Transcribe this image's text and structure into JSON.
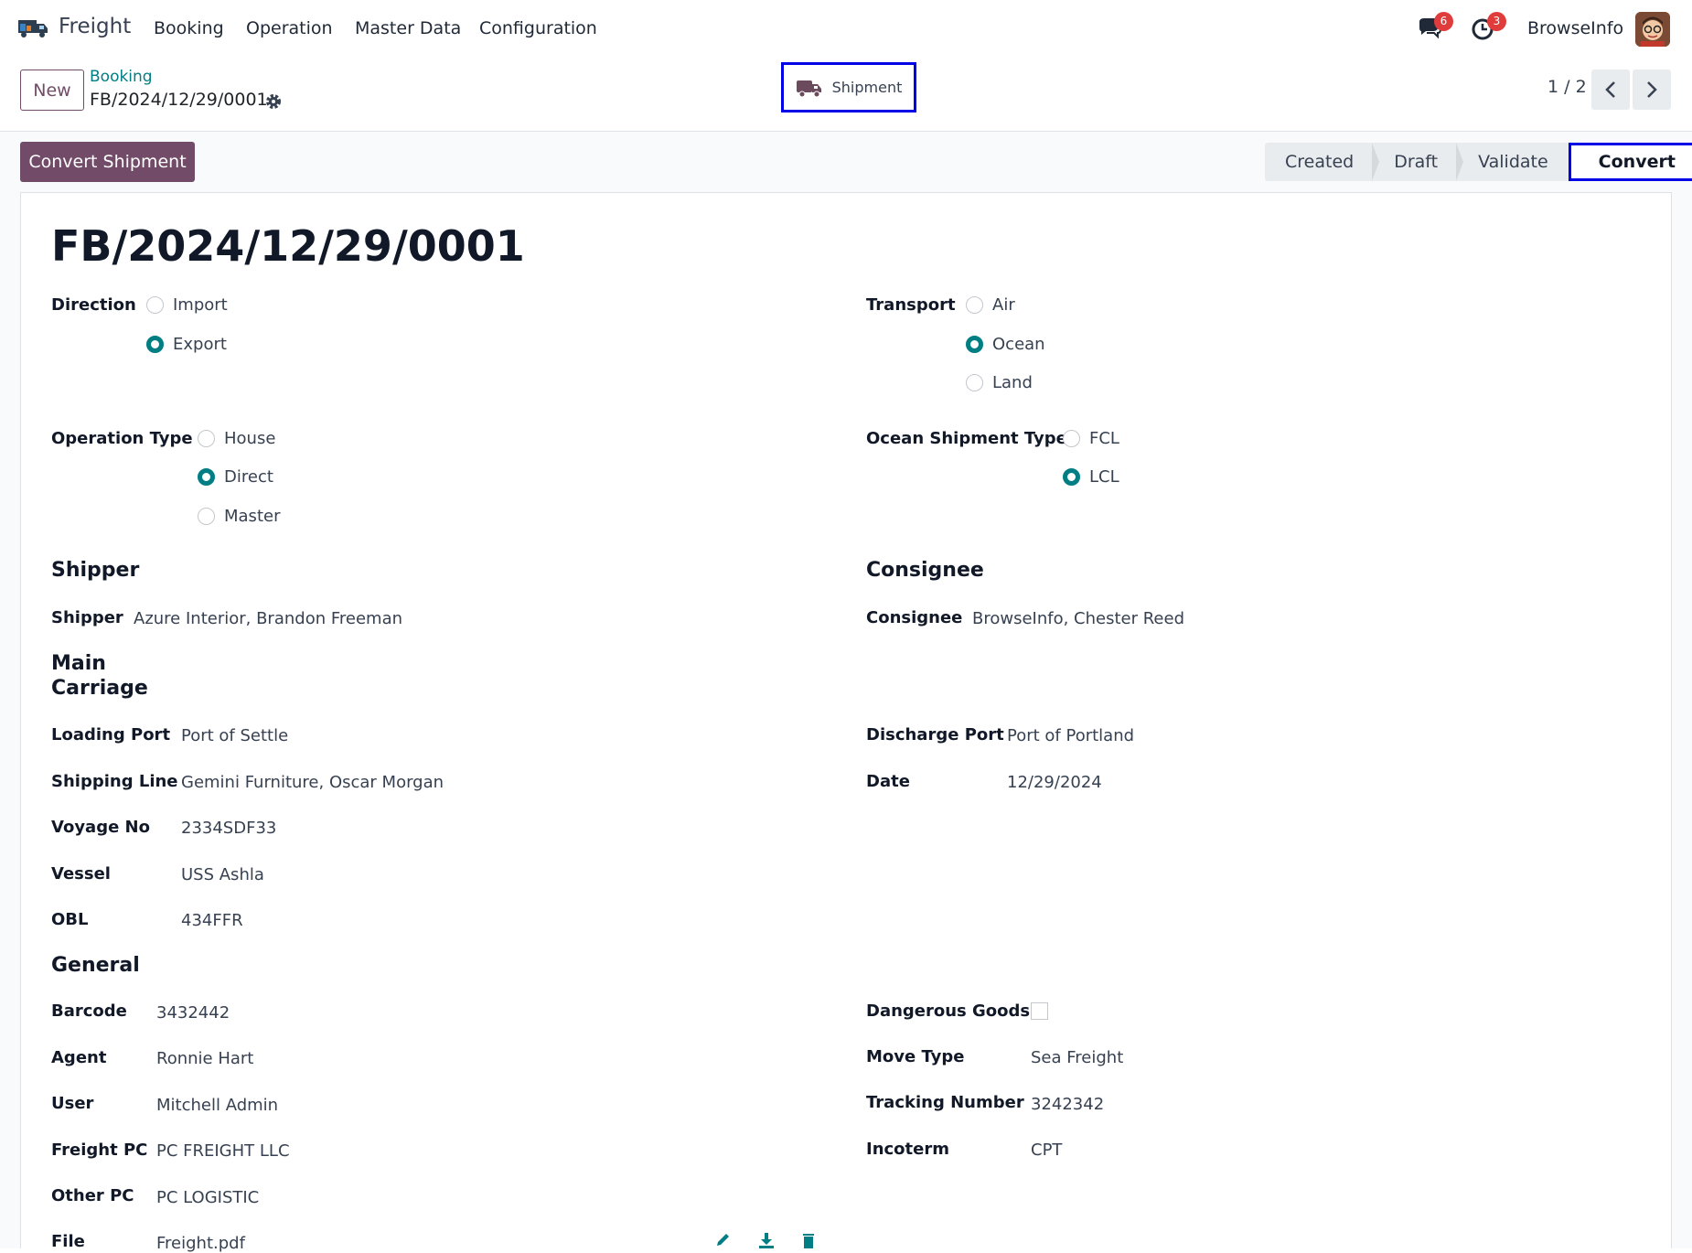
{
  "navbar": {
    "app_name": "Freight",
    "menu": [
      "Booking",
      "Operation",
      "Master Data",
      "Configuration"
    ],
    "messages_count": "6",
    "activities_count": "3",
    "user_name": "BrowseInfo"
  },
  "control": {
    "new_label": "New",
    "breadcrumb_parent": "Booking",
    "breadcrumb_current": "FB/2024/12/29/0001",
    "smart_button_label": "Shipment",
    "pager": "1 / 2"
  },
  "statusbar": {
    "action_label": "Convert Shipment",
    "stages": [
      "Created",
      "Draft",
      "Validate",
      "Convert"
    ],
    "active_stage": "Convert"
  },
  "form": {
    "title": "FB/2024/12/29/0001",
    "direction": {
      "label": "Direction",
      "options": [
        "Import",
        "Export"
      ],
      "selected": "Export"
    },
    "transport": {
      "label": "Transport",
      "options": [
        "Air",
        "Ocean",
        "Land"
      ],
      "selected": "Ocean"
    },
    "operation_type": {
      "label": "Operation Type",
      "options": [
        "House",
        "Direct",
        "Master"
      ],
      "selected": "Direct"
    },
    "ocean_shipment_type": {
      "label": "Ocean Shipment Type",
      "options": [
        "FCL",
        "LCL"
      ],
      "selected": "LCL"
    },
    "shipper_section": "Shipper",
    "consignee_section": "Consignee",
    "shipper": {
      "label": "Shipper",
      "value": "Azure Interior, Brandon Freeman"
    },
    "consignee": {
      "label": "Consignee",
      "value": "BrowseInfo, Chester Reed"
    },
    "main_carriage_section": "Main Carriage",
    "loading_port": {
      "label": "Loading Port",
      "value": "Port of Settle"
    },
    "discharge_port": {
      "label": "Discharge Port",
      "value": "Port of Portland"
    },
    "shipping_line": {
      "label": "Shipping Line",
      "value": "Gemini Furniture, Oscar Morgan"
    },
    "date": {
      "label": "Date",
      "value": "12/29/2024"
    },
    "voyage_no": {
      "label": "Voyage No",
      "value": "2334SDF33"
    },
    "vessel": {
      "label": "Vessel",
      "value": "USS Ashla"
    },
    "obl": {
      "label": "OBL",
      "value": "434FFR"
    },
    "general_section": "General",
    "barcode": {
      "label": "Barcode",
      "value": "3432442"
    },
    "dangerous_goods": {
      "label": "Dangerous Goods",
      "checked": false
    },
    "agent": {
      "label": "Agent",
      "value": "Ronnie Hart"
    },
    "move_type": {
      "label": "Move Type",
      "value": "Sea Freight"
    },
    "user": {
      "label": "User",
      "value": "Mitchell Admin"
    },
    "tracking_number": {
      "label": "Tracking Number",
      "value": "3242342"
    },
    "freight_pc": {
      "label": "Freight PC",
      "value": "PC FREIGHT LLC"
    },
    "incoterm": {
      "label": "Incoterm",
      "value": "CPT"
    },
    "other_pc": {
      "label": "Other PC",
      "value": "PC LOGISTIC"
    },
    "file": {
      "label": "File",
      "value": "Freight.pdf"
    }
  },
  "colors": {
    "brand": "#714b67",
    "accent": "#017e84",
    "highlight": "#0000e6",
    "badge": "#e03c3c"
  },
  "icons": [
    "freight-truck-icon",
    "chat-icon",
    "clock-icon",
    "gear-icon",
    "truck-icon",
    "chevron-left-icon",
    "chevron-right-icon",
    "pencil-icon",
    "download-icon",
    "trash-icon"
  ]
}
